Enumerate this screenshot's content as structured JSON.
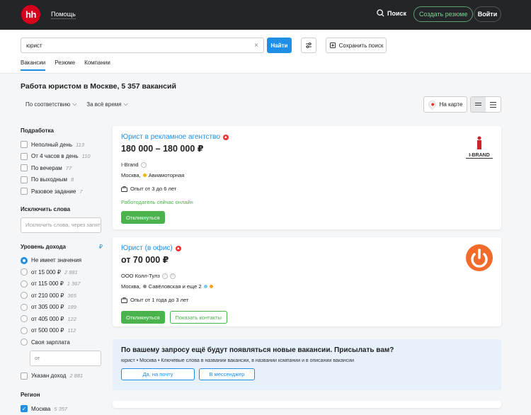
{
  "header": {
    "logo": "hh",
    "help": "Помощь",
    "search": "Поиск",
    "create_resume": "Создать резюме",
    "login": "Войти"
  },
  "search": {
    "query": "юрист",
    "find": "Найти",
    "save_search": "Сохранить поиск"
  },
  "tabs": [
    "Вакансии",
    "Резюме",
    "Компании"
  ],
  "title": "Работа юристом в Москве, 5 357 вакансий",
  "sort": {
    "relevance": "По соответствию",
    "period": "За всё время"
  },
  "map_button": "На карте",
  "filters": {
    "schedule_heading": "Подработка",
    "schedule": [
      {
        "label": "Неполный день",
        "count": "113"
      },
      {
        "label": "От 4 часов в день",
        "count": "110"
      },
      {
        "label": "По вечерам",
        "count": "77"
      },
      {
        "label": "По выходным",
        "count": "8"
      },
      {
        "label": "Разовое задание",
        "count": "7"
      }
    ],
    "exclude_heading": "Исключить слова",
    "exclude_placeholder": "Исключить слова, через запятую",
    "income_heading": "Уровень дохода",
    "currency_symbol": "₽",
    "income": [
      {
        "label": "Не имеет значения",
        "count": "",
        "checked": true
      },
      {
        "label": "от 15 000 ₽",
        "count": "2 881",
        "checked": false
      },
      {
        "label": "от 115 000 ₽",
        "count": "1 367",
        "checked": false
      },
      {
        "label": "от 210 000 ₽",
        "count": "365",
        "checked": false
      },
      {
        "label": "от 305 000 ₽",
        "count": "189",
        "checked": false
      },
      {
        "label": "от 405 000 ₽",
        "count": "122",
        "checked": false
      },
      {
        "label": "от 500 000 ₽",
        "count": "112",
        "checked": false
      },
      {
        "label": "Своя зарплата",
        "count": "",
        "checked": false
      }
    ],
    "own_salary_placeholder": "от",
    "income_specified": {
      "label": "Указан доход",
      "count": "2 881"
    },
    "region_heading": "Регион",
    "region": {
      "label": "Москва",
      "count": "5 357"
    }
  },
  "vacancies": [
    {
      "title": "Юрист в рекламное агентство",
      "salary": "180 000 – 180 000 ₽",
      "company": "I-Brand",
      "city": "Москва,",
      "metro": "Авиамоторная",
      "metro_color": "#f5b800",
      "experience": "Опыт от 3 до 6 лет",
      "online": "Работодатель сейчас онлайн",
      "respond": "Откликнуться",
      "logo_text": "I-BRAND"
    },
    {
      "title": "Юрист (в офис)",
      "salary": "от 70 000 ₽",
      "company": "ООО Колл-Тулз",
      "city": "Москва,",
      "metro": "Савёловская и еще 2",
      "metro_color": "#8a8a8a",
      "experience": "Опыт от 1 года до 3 лет",
      "respond": "Откликнуться",
      "show_contacts": "Показать контакты",
      "logo_color": "#f26b2a"
    }
  ],
  "subscribe": {
    "title": "По вашему запросу ещё будут появляться новые вакансии. Присылать вам?",
    "text": "юрист • Москва • Ключевые слова в названии вакансии, в названии компании и в описании вакансии",
    "yes_email": "Да, на почту",
    "messenger": "В мессенджер"
  }
}
